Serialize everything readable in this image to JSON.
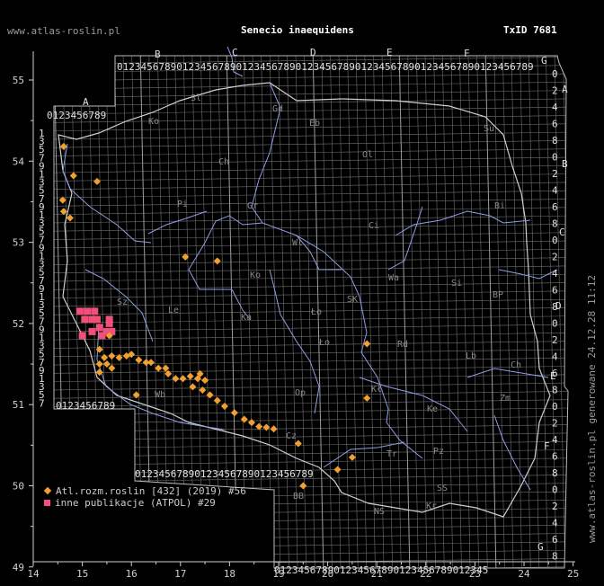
{
  "header": {
    "site": "www.atlas-roslin.pl",
    "title": "Senecio inaequidens",
    "taxid": "TxID 7681",
    "vertical": "www.atlas-roslin.pl generowane 24.12.28 11:12"
  },
  "axes": {
    "x_ticks": [
      "14",
      "15",
      "16",
      "17",
      "18",
      "19",
      "20",
      "21",
      "22",
      "23",
      "24",
      "25"
    ],
    "y_ticks": [
      "55",
      "54",
      "53",
      "52",
      "51",
      "50",
      "49"
    ]
  },
  "grid": {
    "columns": [
      "A",
      "B",
      "C",
      "D",
      "E",
      "F",
      "G"
    ],
    "rows": [
      "A",
      "B",
      "C",
      "D",
      "E",
      "F",
      "G"
    ],
    "digits": "0123456789",
    "regions": [
      "Sl",
      "Gd",
      "Eb",
      "Su",
      "Ko",
      "Ch",
      "Ol",
      "Bi",
      "Pi",
      "Ci",
      "Gr",
      "Wl",
      "Ko",
      "Si",
      "BP",
      "Le",
      "Ło",
      "SK",
      "Sz",
      "Ka",
      "Wa",
      "Rd",
      "Ło",
      "Lb",
      "Ch",
      "Wb",
      "Op",
      "Kł",
      "Zm",
      "Cz",
      "Ke",
      "Tr",
      "Pz",
      "SS",
      "BB",
      "NS",
      "Kr"
    ],
    "colors": {
      "grid": "#6f6f6f",
      "border": "#bdbdbd",
      "rivers": "#8d9fe2",
      "axis": "#cfcfcf"
    }
  },
  "legend": [
    {
      "label": "Atl.rozm.roslin [432] (2019) #56",
      "color": "#f0a030",
      "marker": "diamond"
    },
    {
      "label": "inne publikacje (ATPOL) #29",
      "color": "#f0507a",
      "marker": "square"
    }
  ],
  "records": {
    "orange": [
      [
        14.62,
        54.18
      ],
      [
        14.82,
        53.82
      ],
      [
        15.3,
        53.75
      ],
      [
        14.6,
        53.52
      ],
      [
        14.62,
        53.38
      ],
      [
        14.75,
        53.3
      ],
      [
        17.1,
        52.82
      ],
      [
        17.75,
        52.77
      ],
      [
        15.55,
        51.85
      ],
      [
        15.35,
        51.68
      ],
      [
        15.45,
        51.58
      ],
      [
        15.6,
        51.6
      ],
      [
        15.75,
        51.58
      ],
      [
        15.9,
        51.6
      ],
      [
        16.0,
        51.62
      ],
      [
        16.15,
        51.55
      ],
      [
        16.3,
        51.52
      ],
      [
        16.4,
        51.52
      ],
      [
        16.55,
        51.45
      ],
      [
        16.75,
        51.38
      ],
      [
        16.9,
        51.32
      ],
      [
        17.05,
        51.32
      ],
      [
        17.2,
        51.35
      ],
      [
        17.35,
        51.32
      ],
      [
        17.5,
        51.3
      ],
      [
        17.45,
        51.18
      ],
      [
        17.6,
        51.12
      ],
      [
        17.75,
        51.05
      ],
      [
        17.9,
        50.98
      ],
      [
        18.1,
        50.9
      ],
      [
        18.3,
        50.82
      ],
      [
        18.45,
        50.78
      ],
      [
        18.6,
        50.73
      ],
      [
        18.75,
        50.72
      ],
      [
        18.9,
        50.7
      ],
      [
        16.1,
        51.12
      ],
      [
        17.25,
        51.22
      ],
      [
        17.4,
        51.38
      ],
      [
        16.7,
        51.45
      ],
      [
        19.4,
        50.52
      ],
      [
        19.5,
        50.0
      ],
      [
        20.2,
        50.2
      ],
      [
        20.5,
        50.35
      ],
      [
        20.8,
        51.08
      ],
      [
        20.8,
        51.75
      ],
      [
        15.35,
        51.5
      ],
      [
        15.5,
        51.5
      ],
      [
        15.6,
        51.45
      ],
      [
        15.35,
        51.4
      ]
    ],
    "pink": [
      [
        14.95,
        52.15
      ],
      [
        15.1,
        52.15
      ],
      [
        15.25,
        52.15
      ],
      [
        15.05,
        52.05
      ],
      [
        15.3,
        52.05
      ],
      [
        15.55,
        52.0
      ],
      [
        15.35,
        51.95
      ],
      [
        15.5,
        51.9
      ],
      [
        15.2,
        51.9
      ],
      [
        15.0,
        51.85
      ],
      [
        15.6,
        51.9
      ],
      [
        15.4,
        51.85
      ],
      [
        15.55,
        52.05
      ],
      [
        15.2,
        52.05
      ]
    ]
  }
}
